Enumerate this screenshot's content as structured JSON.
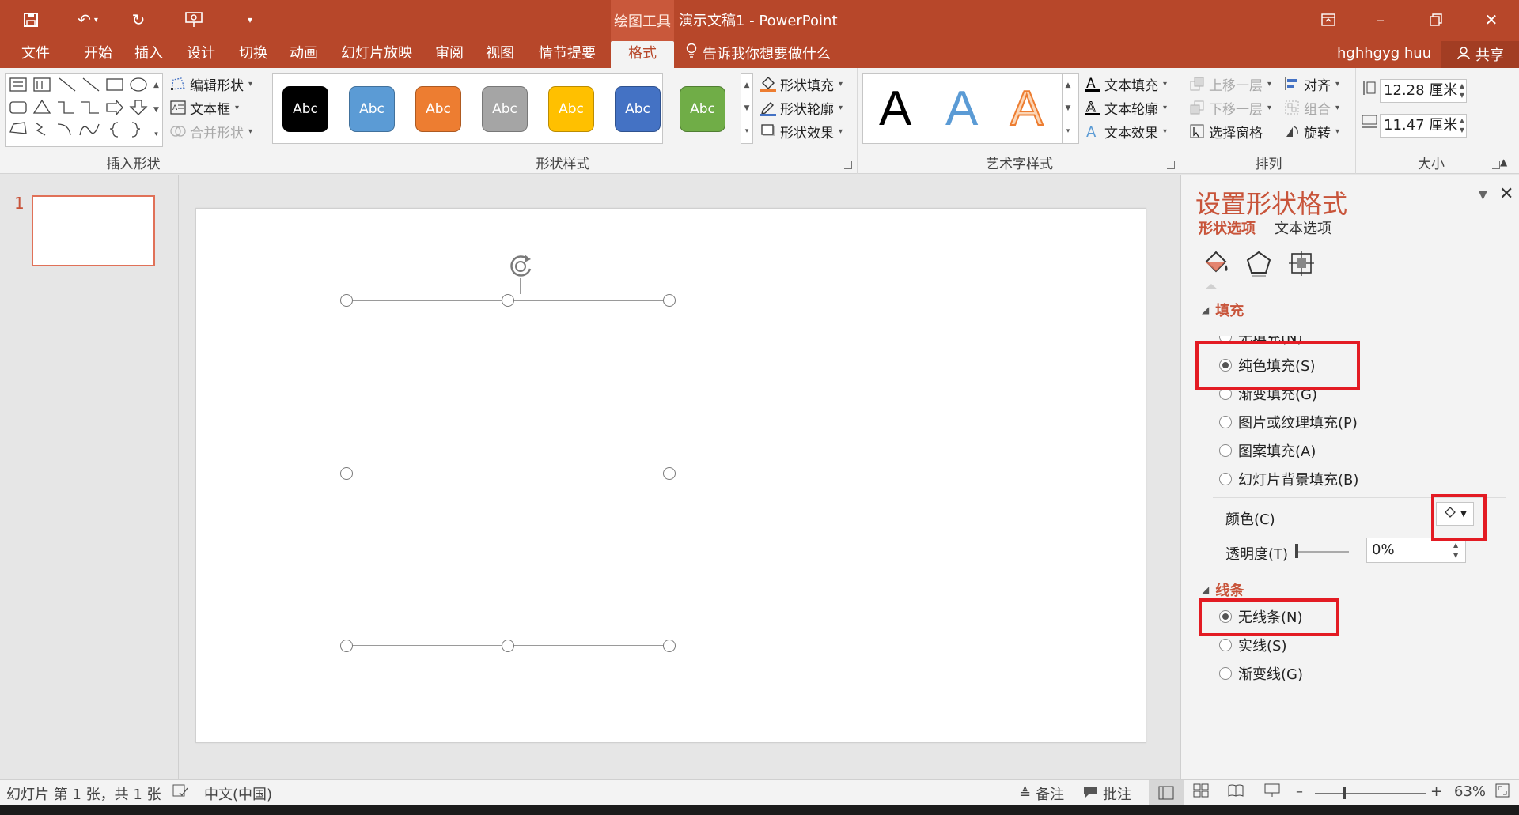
{
  "titlebar": {
    "context_group": "绘图工具",
    "doc_title": "演示文稿1 - PowerPoint",
    "bg_color": "#b7472a"
  },
  "tabs": {
    "items": [
      "文件",
      "开始",
      "插入",
      "设计",
      "切换",
      "动画",
      "幻灯片放映",
      "审阅",
      "视图",
      "情节提要",
      "格式"
    ],
    "active": "格式",
    "tell_me": "告诉我你想要做什么",
    "user": "hghhgyg huu",
    "share": "共享"
  },
  "ribbon": {
    "insert_shapes": {
      "label": "插入形状",
      "edit_shape": "编辑形状",
      "text_box": "文本框",
      "merge_shapes": "合并形状"
    },
    "shape_styles": {
      "label": "形状样式",
      "swatch_text": "Abc",
      "swatches": [
        "#000000",
        "#5b9bd5",
        "#ed7d31",
        "#a5a5a5",
        "#ffc000",
        "#4472c4",
        "#70ad47"
      ],
      "shape_fill": "形状填充",
      "shape_outline": "形状轮廓",
      "shape_effects": "形状效果"
    },
    "wordart_styles": {
      "label": "艺术字样式",
      "letter": "A",
      "text_fill": "文本填充",
      "text_outline": "文本轮廓",
      "text_effects": "文本效果"
    },
    "arrange": {
      "label": "排列",
      "bring_forward": "上移一层",
      "send_backward": "下移一层",
      "selection_pane": "选择窗格",
      "align": "对齐",
      "group": "组合",
      "rotate": "旋转"
    },
    "size": {
      "label": "大小",
      "height": "12.28 厘米",
      "width": "11.47 厘米"
    }
  },
  "thumbnails": {
    "slide_number": "1"
  },
  "format_pane": {
    "title": "设置形状格式",
    "tab_shape": "形状选项",
    "tab_text": "文本选项",
    "fill_section": "填充",
    "fill_options": [
      "无填充(N)",
      "纯色填充(S)",
      "渐变填充(G)",
      "图片或纹理填充(P)",
      "图案填充(A)",
      "幻灯片背景填充(B)"
    ],
    "fill_selected_index": 1,
    "color_label": "颜色(C)",
    "transparency_label": "透明度(T)",
    "transparency_value": "0%",
    "line_section": "线条",
    "line_options": [
      "无线条(N)",
      "实线(S)",
      "渐变线(G)"
    ],
    "line_selected_index": 0,
    "highlight_color": "#e31b23"
  },
  "statusbar": {
    "slide_info": "幻灯片 第 1 张，共 1 张",
    "language": "中文(中国)",
    "notes": "备注",
    "comments": "批注",
    "zoom": "63%"
  }
}
